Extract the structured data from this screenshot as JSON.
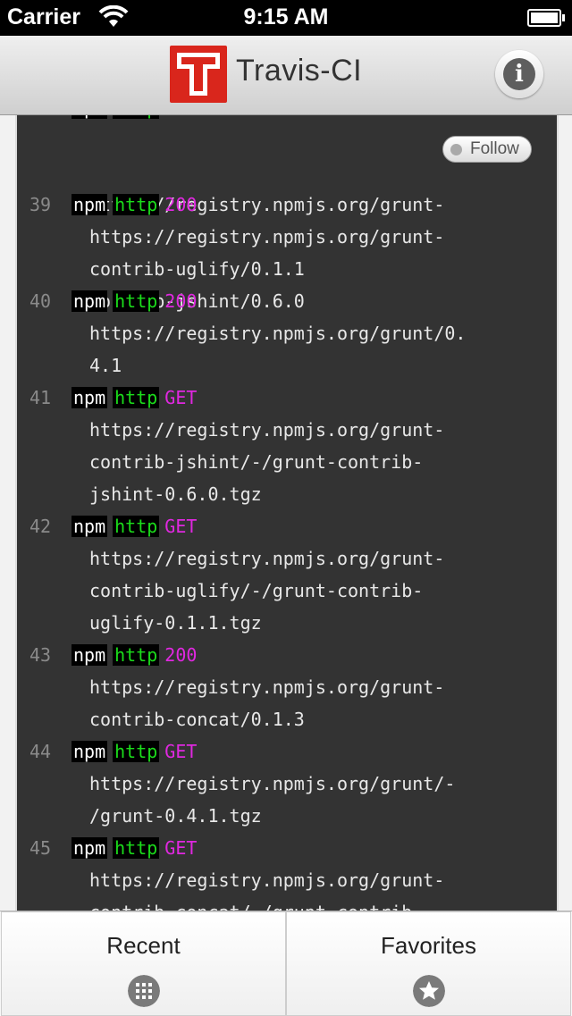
{
  "status_bar": {
    "carrier": "Carrier",
    "time": "9:15 AM"
  },
  "navbar": {
    "title": "Travis-CI",
    "logo_letter": "T",
    "info_glyph": "i"
  },
  "follow_label": "Follow",
  "colors": {
    "npm_bg": "#000000",
    "http_fg": "#1bdc1b",
    "status_fg": "#e028e0",
    "log_bg": "#333333",
    "logo": "#d9261c"
  },
  "log": {
    "partial_top": [
      "https://registry.npmjs.org/grunt-",
      "contrib-jshint/0.6.0"
    ],
    "lines": [
      {
        "num": "39",
        "npm": "npm",
        "http": "http",
        "status": "200",
        "text": [
          "https://registry.npmjs.org/grunt-",
          "contrib-uglify/0.1.1"
        ]
      },
      {
        "num": "40",
        "npm": "npm",
        "http": "http",
        "status": "200",
        "text": [
          "https://registry.npmjs.org/grunt/0.",
          "4.1"
        ]
      },
      {
        "num": "41",
        "npm": "npm",
        "http": "http",
        "status": "GET",
        "text": [
          "https://registry.npmjs.org/grunt-",
          "contrib-jshint/-/grunt-contrib-",
          "jshint-0.6.0.tgz"
        ]
      },
      {
        "num": "42",
        "npm": "npm",
        "http": "http",
        "status": "GET",
        "text": [
          "https://registry.npmjs.org/grunt-",
          "contrib-uglify/-/grunt-contrib-",
          "uglify-0.1.1.tgz"
        ]
      },
      {
        "num": "43",
        "npm": "npm",
        "http": "http",
        "status": "200",
        "text": [
          "https://registry.npmjs.org/grunt-",
          "contrib-concat/0.1.3"
        ]
      },
      {
        "num": "44",
        "npm": "npm",
        "http": "http",
        "status": "GET",
        "text": [
          "https://registry.npmjs.org/grunt/-",
          "/grunt-0.4.1.tgz"
        ]
      },
      {
        "num": "45",
        "npm": "npm",
        "http": "http",
        "status": "GET",
        "text": [
          "https://registry.npmjs.org/grunt-",
          "contrib-concat/-/grunt-contrib-"
        ]
      }
    ]
  },
  "tabs": [
    {
      "label": "Recent",
      "icon": "grid-icon"
    },
    {
      "label": "Favorites",
      "icon": "star-icon"
    }
  ]
}
